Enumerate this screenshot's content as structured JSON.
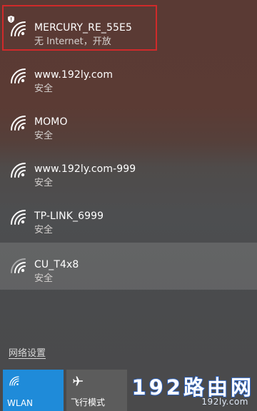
{
  "networks": [
    {
      "name": "MERCURY_RE_55E5",
      "status": "无 Internet，开放"
    },
    {
      "name": "www.192ly.com",
      "status": "安全"
    },
    {
      "name": "MOMO",
      "status": "安全"
    },
    {
      "name": "www.192ly.com-999",
      "status": "安全"
    },
    {
      "name": "TP-LINK_6999",
      "status": "安全"
    },
    {
      "name": "CU_T4x8",
      "status": "安全"
    }
  ],
  "network_settings_label": "网络设置",
  "quick_actions": {
    "wlan_label": "WLAN",
    "airplane_label": "飞行模式"
  },
  "watermark": {
    "main": "192路由网",
    "sub": "192ly.com"
  },
  "colors": {
    "wlan_tile": "#1f8bd9",
    "highlight_outline": "#d02a2a"
  },
  "icons": {
    "network": "wifi-icon",
    "open_network_warning": "shield-icon",
    "wlan": "wifi-icon",
    "airplane": "airplane-icon"
  }
}
